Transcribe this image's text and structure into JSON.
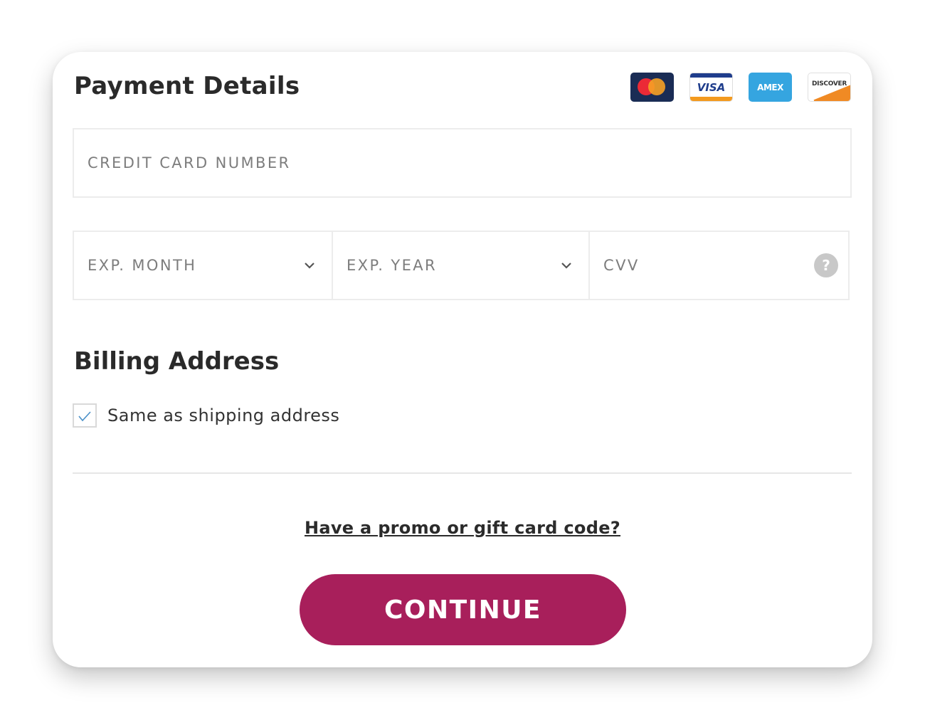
{
  "payment": {
    "title": "Payment Details",
    "card_brands": [
      {
        "name": "mastercard",
        "label": ""
      },
      {
        "name": "visa",
        "label": "VISA"
      },
      {
        "name": "amex",
        "label": "AMEX"
      },
      {
        "name": "discover",
        "label": "DISCOVER"
      }
    ],
    "card_number": {
      "placeholder": "CREDIT CARD NUMBER",
      "value": ""
    },
    "exp_month": {
      "placeholder": "EXP. MONTH",
      "selected": ""
    },
    "exp_year": {
      "placeholder": "EXP. YEAR",
      "selected": ""
    },
    "cvv": {
      "placeholder": "CVV",
      "value": "",
      "help_icon": "?"
    }
  },
  "billing": {
    "title": "Billing Address",
    "same_as_shipping": {
      "label": "Same as shipping address",
      "checked": true
    }
  },
  "promo_link": "Have a promo or gift card code?",
  "continue_label": "CONTINUE",
  "colors": {
    "accent": "#a81f5b",
    "border": "#ececec",
    "placeholder": "#7d7d7d",
    "check": "#4a90c8"
  },
  "icons": [
    "mastercard-logo-icon",
    "visa-logo-icon",
    "amex-logo-icon",
    "discover-logo-icon",
    "chevron-down-icon",
    "help-icon",
    "checkmark-icon"
  ]
}
